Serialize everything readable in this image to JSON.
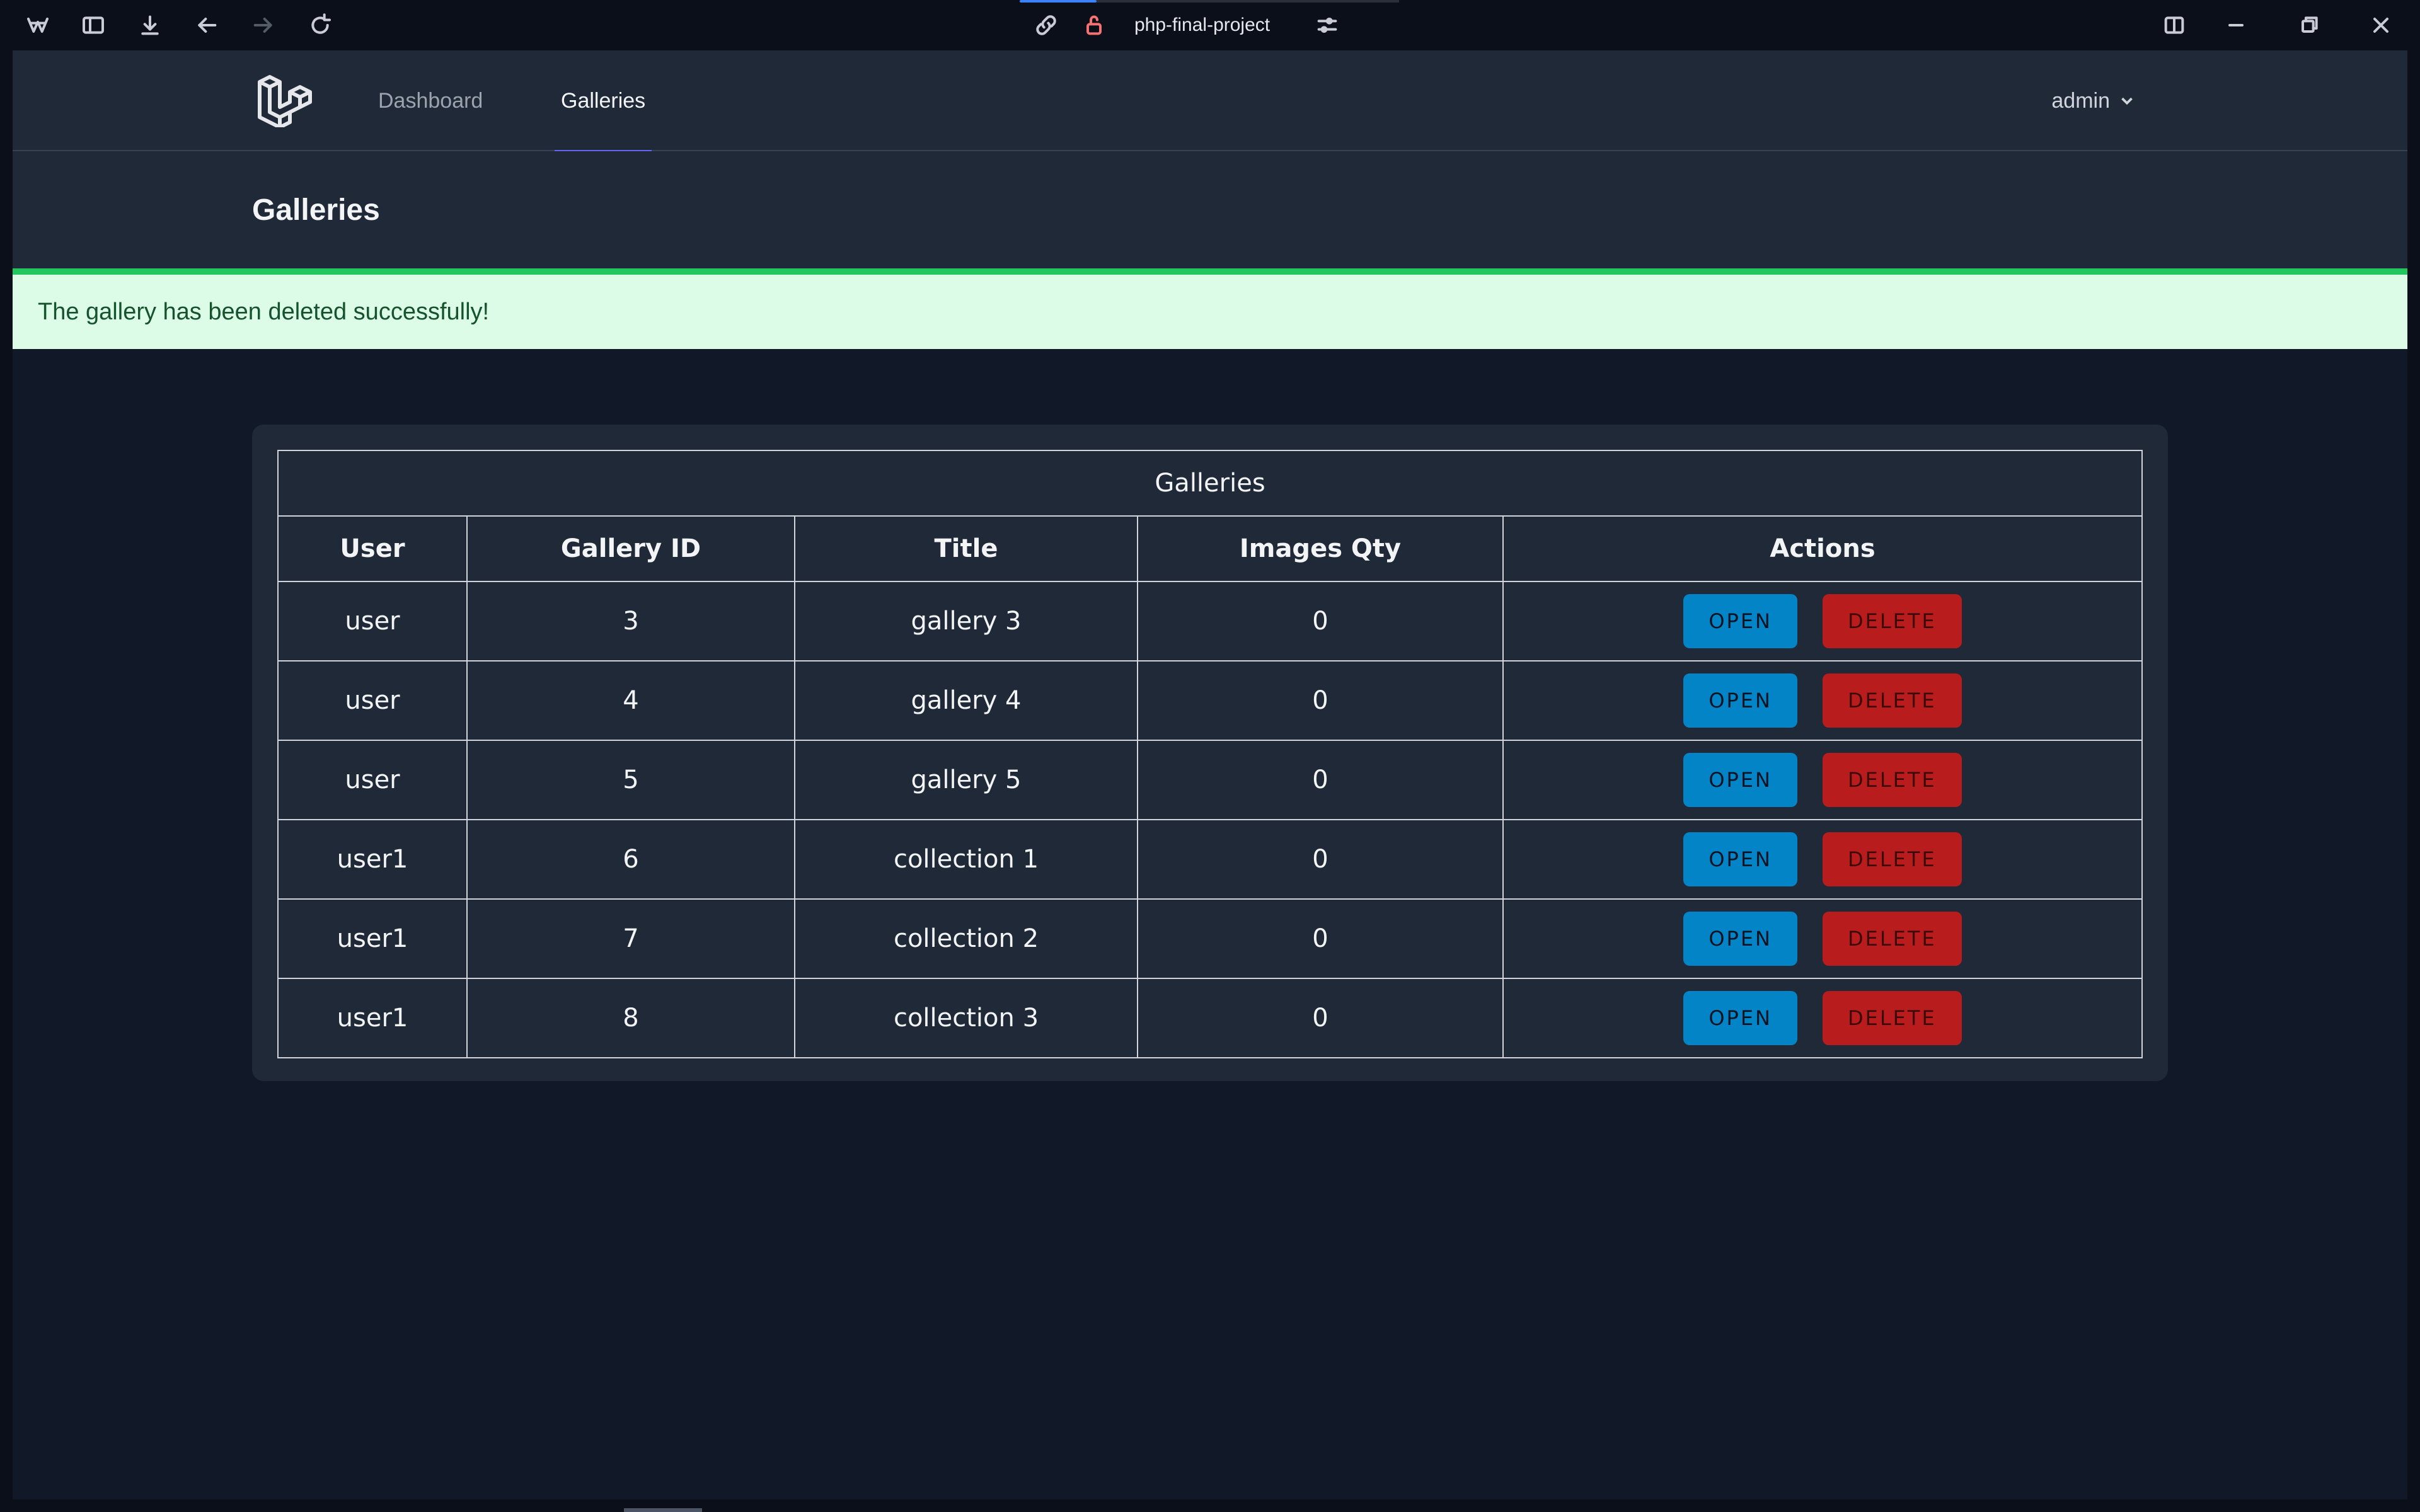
{
  "browser": {
    "address": "php-final-project",
    "icons": [
      "browser-logo-icon",
      "sidebar-toggle-icon",
      "download-icon",
      "back-icon",
      "forward-icon",
      "reload-icon",
      "link-icon",
      "lock-icon",
      "site-settings-icon",
      "split-view-icon",
      "minimize-icon",
      "restore-icon",
      "close-icon"
    ]
  },
  "nav": {
    "links": [
      {
        "label": "Dashboard",
        "active": false
      },
      {
        "label": "Galleries",
        "active": true
      }
    ],
    "user": "admin"
  },
  "header": {
    "title": "Galleries"
  },
  "alert": {
    "message": "The gallery has been deleted successfully!",
    "color": "#dcfce7"
  },
  "table": {
    "caption": "Galleries",
    "columns": [
      "User",
      "Gallery ID",
      "Title",
      "Images Qty",
      "Actions"
    ],
    "rows": [
      {
        "user": "user",
        "id": "3",
        "title": "gallery 3",
        "qty": "0"
      },
      {
        "user": "user",
        "id": "4",
        "title": "gallery 4",
        "qty": "0"
      },
      {
        "user": "user",
        "id": "5",
        "title": "gallery 5",
        "qty": "0"
      },
      {
        "user": "user1",
        "id": "6",
        "title": "collection 1",
        "qty": "0"
      },
      {
        "user": "user1",
        "id": "7",
        "title": "collection 2",
        "qty": "0"
      },
      {
        "user": "user1",
        "id": "8",
        "title": "collection 3",
        "qty": "0"
      }
    ],
    "open_label": "OPEN",
    "delete_label": "DELETE"
  },
  "colors": {
    "accent": "#6366f1",
    "open": "#0284c7",
    "delete": "#b91c1c",
    "success": "#22c55e"
  }
}
